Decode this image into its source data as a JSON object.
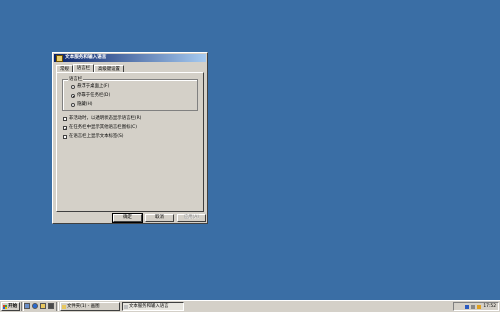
{
  "dialog": {
    "title": "文本服务和输入语言",
    "tabs": [
      {
        "label": "常规",
        "active": false
      },
      {
        "label": "语言栏",
        "active": true
      },
      {
        "label": "高级键设置",
        "active": false
      }
    ],
    "group_title": "语言栏",
    "radio_options": [
      {
        "label": "悬浮于桌面上(F)",
        "checked": false
      },
      {
        "label": "停靠于任务栏(D)",
        "checked": true
      },
      {
        "label": "隐藏(H)",
        "checked": false
      }
    ],
    "checkboxes": [
      {
        "label": "非活动时，以透明状态显示语言栏(R)",
        "checked": false
      },
      {
        "label": "在任务栏中显示其他语言栏图标(C)",
        "checked": true
      },
      {
        "label": "在语言栏上显示文本标签(S)",
        "checked": false
      }
    ],
    "buttons": {
      "ok": "确定",
      "cancel": "取消",
      "apply": "应用(A)"
    }
  },
  "taskbar": {
    "start_label": "开始",
    "tasks": [
      {
        "label": "文件夹(1) - 画图",
        "active": false
      },
      {
        "label": "文本服务和输入语言",
        "active": true
      }
    ],
    "clock": "17:52"
  },
  "colors": {
    "desktop": "#3a6ea5",
    "titlebar_start": "#0a246a",
    "titlebar_end": "#a6caf0",
    "face": "#d4d0c8"
  }
}
